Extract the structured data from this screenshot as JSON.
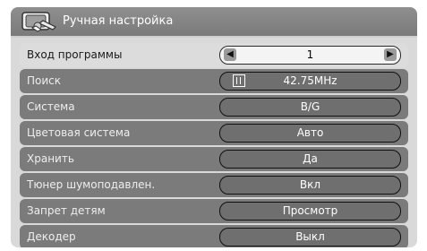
{
  "header": {
    "title": "Ручная настройка",
    "icon": "tv-tools-icon"
  },
  "rows": [
    {
      "label": "Вход программы",
      "value": "1"
    },
    {
      "label": "Поиск",
      "value": "42.75MHz"
    },
    {
      "label": "Система",
      "value": "B/G"
    },
    {
      "label": "Цветовая система",
      "value": "Авто"
    },
    {
      "label": "Хранить",
      "value": "Да"
    },
    {
      "label": "Тюнер шумоподавлен.",
      "value": "Вкл"
    },
    {
      "label": "Запрет детям",
      "value": "Просмотр"
    },
    {
      "label": "Декодер",
      "value": "Выкл"
    }
  ],
  "colors": {
    "panel_bg": "#d9d9d9",
    "row_bg": "#7b7b7b",
    "selected_row_bg": "#dcdcdc"
  }
}
